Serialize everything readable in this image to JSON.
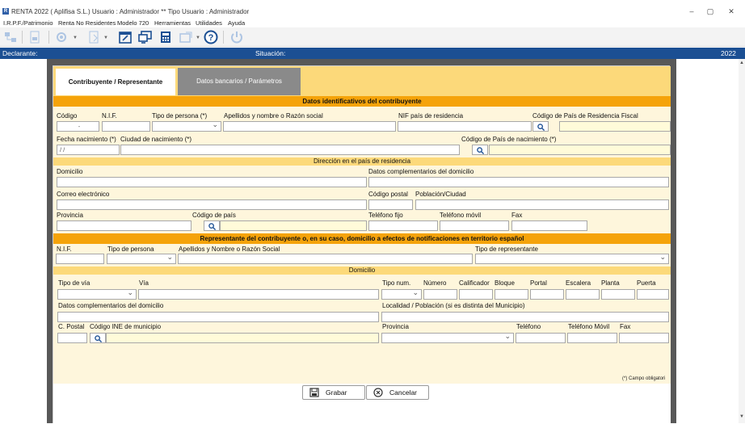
{
  "window": {
    "title": "RENTA 2022 ( Aplifisa S.L.) Usuario : Administrador  **  Tipo Usuario : Administrador",
    "app_icon": "R",
    "minimize": "–",
    "maximize": "▢",
    "close": "✕"
  },
  "menu": [
    "I.R.P.F./Patrimonio",
    "Renta No Residentes",
    "Modelo 720",
    "Herramientas",
    "Utilidades",
    "Ayuda"
  ],
  "statusbar": {
    "declarante_label": "Declarante:",
    "situacion_label": "Situación:",
    "year": "2022",
    "color": "#1b4f93"
  },
  "tabs": {
    "active": "Contribuyente / Representante",
    "inactive": "Datos bancarios / Parámetros"
  },
  "sections": {
    "datos": "Datos identificativos del contribuyente",
    "direccion": "Dirección en el país de residencia",
    "representante": "Representante del contribuyente o, en su caso, domicilio a efectos de notificaciones en territorio español",
    "domicilio": "Domicilio"
  },
  "contrib": {
    "codigo": "Código",
    "codigo_value": "-",
    "nif": "N.I.F.",
    "tipo_persona": "Tipo de persona (*)",
    "apellidos": "Apellidos y nombre o Razón social",
    "nif_pais": "NIF país de residencia",
    "cod_pais_res": "Código de País de Residencia Fiscal",
    "fecha_nac": "Fecha nacimiento (*)",
    "fecha_value": " /  /",
    "ciudad_nac": "Ciudad de nacimiento (*)",
    "cod_pais_nac": "Código de País de nacimiento (*)"
  },
  "direccion": {
    "domicilio": "Domicilio",
    "datos_compl": "Datos complementarios del domicilio",
    "correo": "Correo electrónico",
    "cod_postal": "Código postal",
    "poblacion": "Población/Ciudad",
    "provincia": "Provincia",
    "cod_pais": "Código de país",
    "tel_fijo": "Teléfono fijo",
    "tel_movil": "Teléfono móvil",
    "fax": "Fax"
  },
  "repres": {
    "nif": "N.I.F.",
    "tipo_persona": "Tipo de persona",
    "apellidos": "Apellidos y Nombre o Razón Social",
    "tipo_repres": "Tipo de representante"
  },
  "domicilio": {
    "tipo_via": "Tipo de vía",
    "via": "Vía",
    "tipo_num": "Tipo num.",
    "numero": "Número",
    "calificador": "Calificador",
    "bloque": "Bloque",
    "portal": "Portal",
    "escalera": "Escalera",
    "planta": "Planta",
    "puerta": "Puerta",
    "datos_compl": "Datos complementarios del domicilio",
    "localidad": "Localidad / Población (si es distinta del Municipio)",
    "c_postal": "C. Postal",
    "cod_ine": "Código INE de municipio",
    "provincia": "Provincia",
    "telefono": "Teléfono",
    "tel_movil": "Teléfono Móvil",
    "fax": "Fax"
  },
  "note": "(*) Campo obligatori",
  "buttons": {
    "grabar": "Grabar",
    "cancelar": "Cancelar"
  }
}
